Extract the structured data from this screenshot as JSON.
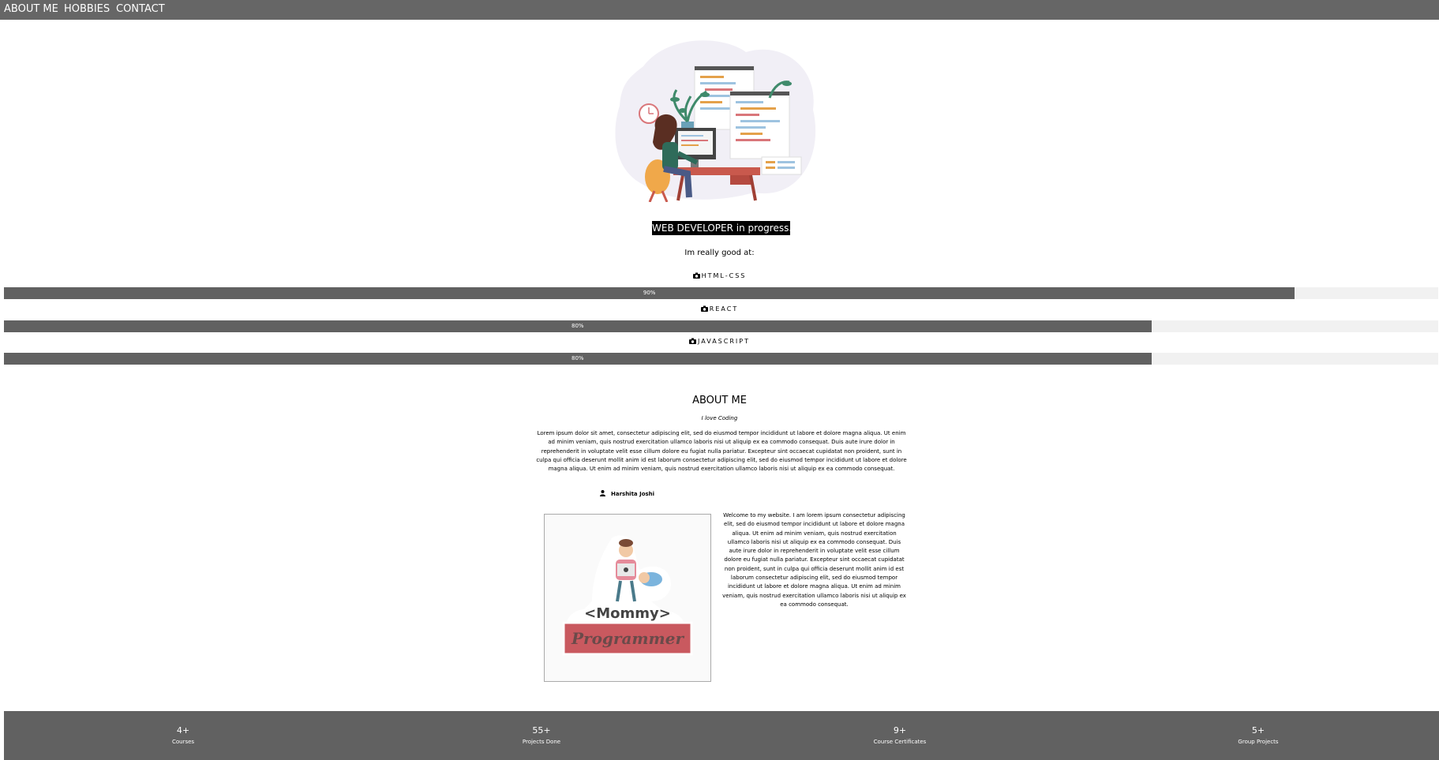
{
  "nav": {
    "about": "ABOUT ME",
    "hobbies": "HOBBIES",
    "contact": "CONTACT"
  },
  "hero": {
    "tagline": "WEB DEVELOPER in progress...",
    "good_at": "Im really good at:"
  },
  "skills": [
    {
      "name": "HTML-CSS",
      "percent_label": "90%",
      "percent": 90
    },
    {
      "name": "REACT",
      "percent_label": "80%",
      "percent": 80
    },
    {
      "name": "JAVASCRIPT",
      "percent_label": "80%",
      "percent": 80
    }
  ],
  "about": {
    "title": "ABOUT ME",
    "subtitle": "I love Coding",
    "paragraph": "Lorem ipsum dolor sit amet, consectetur adipiscing elit, sed do eiusmod tempor incididunt ut labore et dolore magna aliqua. Ut enim ad minim veniam, quis nostrud exercitation ullamco laboris nisi ut aliquip ex ea commodo consequat. Duis aute irure dolor in reprehenderit in voluptate velit esse cillum dolore eu fugiat nulla pariatur. Excepteur sint occaecat cupidatat non proident, sunt in culpa qui officia deserunt mollit anim id est laborum consectetur adipiscing elit, sed do eiusmod tempor incididunt ut labore et dolore magna aliqua. Ut enim ad minim veniam, quis nostrud exercitation ullamco laboris nisi ut aliquip ex ea commodo consequat.",
    "author": "Harshita Joshi",
    "welcome": "Welcome to my website. I am lorem ipsum consectetur adipiscing elit, sed do eiusmod tempor incididunt ut labore et dolore magna aliqua. Ut enim ad minim veniam, quis nostrud exercitation ullamco laboris nisi ut aliquip ex ea commodo consequat. Duis aute irure dolor in reprehenderit in voluptate velit esse cillum dolore eu fugiat nulla pariatur. Excepteur sint occaecat cupidatat non proident, sunt in culpa qui officia deserunt mollit anim id est laborum consectetur adipiscing elit, sed do eiusmod tempor incididunt ut labore et dolore magna aliqua. Ut enim ad minim veniam, quis nostrud exercitation ullamco laboris nisi ut aliquip ex ea commodo consequat.",
    "photo_text_top": "<Mommy>",
    "photo_text_bottom": "Programmer"
  },
  "stats": [
    {
      "value": "4+",
      "label": "Courses"
    },
    {
      "value": "55+",
      "label": "Projects Done"
    },
    {
      "value": "9+",
      "label": "Course Certificates"
    },
    {
      "value": "5+",
      "label": "Group Projects"
    }
  ],
  "colors": {
    "nav_bg": "#666666",
    "bar_fill": "#616161",
    "bar_track": "#f1f1f1",
    "footer_bg": "#616161",
    "tagline_bg": "#000000"
  },
  "icons": {
    "skill_icon": "camera-icon",
    "author_icon": "user-icon"
  }
}
